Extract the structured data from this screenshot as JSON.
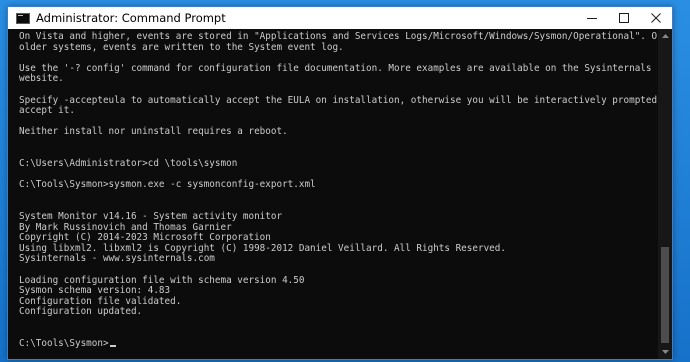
{
  "window": {
    "title": "Administrator: Command Prompt",
    "controls": {
      "minimize": "minimize-icon",
      "maximize": "maximize-icon",
      "close": "close-icon"
    }
  },
  "console": {
    "lines": [
      "On Vista and higher, events are stored in \"Applications and Services Logs/Microsoft/Windows/Sysmon/Operational\". On",
      "older systems, events are written to the System event log.",
      "",
      "Use the '-? config' command for configuration file documentation. More examples are available on the Sysinternals",
      "website.",
      "",
      "Specify -accepteula to automatically accept the EULA on installation, otherwise you will be interactively prompted to",
      "accept it.",
      "",
      "Neither install nor uninstall requires a reboot.",
      "",
      "",
      "C:\\Users\\Administrator>cd \\tools\\sysmon",
      "",
      "C:\\Tools\\Sysmon>sysmon.exe -c sysmonconfig-export.xml",
      "",
      "",
      "System Monitor v14.16 - System activity monitor",
      "By Mark Russinovich and Thomas Garnier",
      "Copyright (C) 2014-2023 Microsoft Corporation",
      "Using libxml2. libxml2 is Copyright (C) 1998-2012 Daniel Veillard. All Rights Reserved.",
      "Sysinternals - www.sysinternals.com",
      "",
      "Loading configuration file with schema version 4.50",
      "Sysmon schema version: 4.83",
      "Configuration file validated.",
      "Configuration updated.",
      "",
      "",
      "C:\\Tools\\Sysmon>"
    ]
  },
  "colors": {
    "console_background": "#0c0c0c",
    "console_text": "#cccccc",
    "titlebar": "#ffffff",
    "desktop": "#1a7fd6"
  }
}
